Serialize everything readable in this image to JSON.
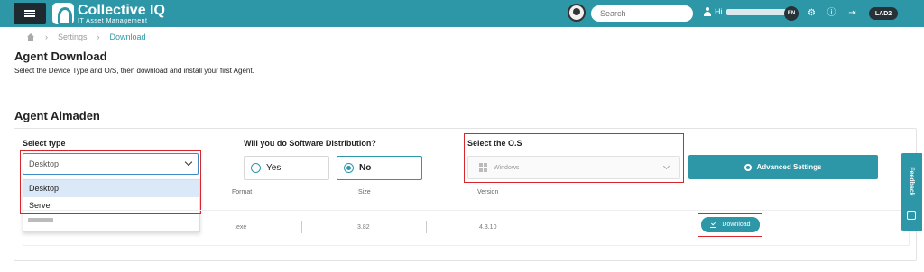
{
  "topbar": {
    "app_title": "Collective IQ",
    "app_subtitle": "IT Asset Management",
    "search_placeholder": "Search",
    "greeting": "Hi",
    "lang": "EN",
    "tenant": "LAD2",
    "brand_color": "#2d97a8"
  },
  "breadcrumb": {
    "items": [
      "Settings",
      "Download"
    ]
  },
  "page": {
    "title": "Agent Download",
    "subtitle": "Select the Device Type and O/S, then download and install your first Agent.",
    "section_title": "Agent Almaden"
  },
  "form": {
    "type_label": "Select type",
    "type_value": "Desktop",
    "type_options": [
      "Desktop",
      "Server"
    ],
    "distribution_label": "Will you do Software Distribution?",
    "yes_label": "Yes",
    "no_label": "No",
    "distribution_selected": "No",
    "os_label": "Select the O.S",
    "os_value": "Windows",
    "advanced_label": "Advanced Settings"
  },
  "table": {
    "headers": [
      "Format",
      "Size",
      "Version"
    ],
    "rows": [
      {
        "format": ".exe",
        "size": "3.82",
        "version": "4.3.10",
        "action": "Download"
      }
    ]
  },
  "feedback_label": "Feedback",
  "icons": [
    "menu-icon",
    "logo-icon",
    "avatar-icon",
    "user-icon",
    "gear-icon",
    "info-icon",
    "logout-icon",
    "home-icon",
    "windows-icon",
    "download-icon",
    "feedback-icon"
  ]
}
